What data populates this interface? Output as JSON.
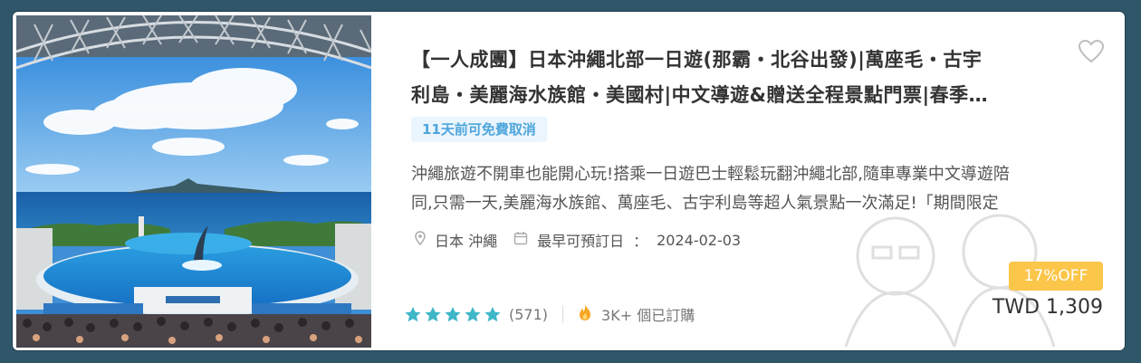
{
  "card": {
    "title_line1": "【一人成團】日本沖繩北部一日遊(那霸・北谷出發)|萬座毛・古宇",
    "title_line2": "利島・美麗海水族館・美國村|中文導遊&贈送全程景點門票|春季…",
    "cancel_tag": "11天前可免費取消",
    "description_line1": "沖繩旅遊不開車也能開心玩!搭乘一日遊巴士輕鬆玩翻沖繩北部,隨車專業中文導遊陪",
    "description_line2": "同,只需一天,美麗海水族館、萬座毛、古宇利島等超人氣景點一次滿足!「期間限定",
    "location": "日本 沖繩",
    "earliest_label": "最早可預訂日",
    "colon": "：",
    "earliest_date": "2024-02-03",
    "discount": "17%OFF",
    "price": "TWD 1,309",
    "rating_count": "(571)",
    "booked": "3K+ 個已訂購",
    "rating": 5
  },
  "icons": {
    "favorite": "heart-outline-icon",
    "location": "map-pin-icon",
    "calendar": "calendar-icon",
    "booked": "fire-icon",
    "star": "star-icon"
  },
  "colors": {
    "tag_bg": "#eaf5fd",
    "tag_text": "#4ea6dc",
    "star": "#3fb7c8",
    "discount_bg": "#fcc64a",
    "frame": "#2f5669"
  }
}
